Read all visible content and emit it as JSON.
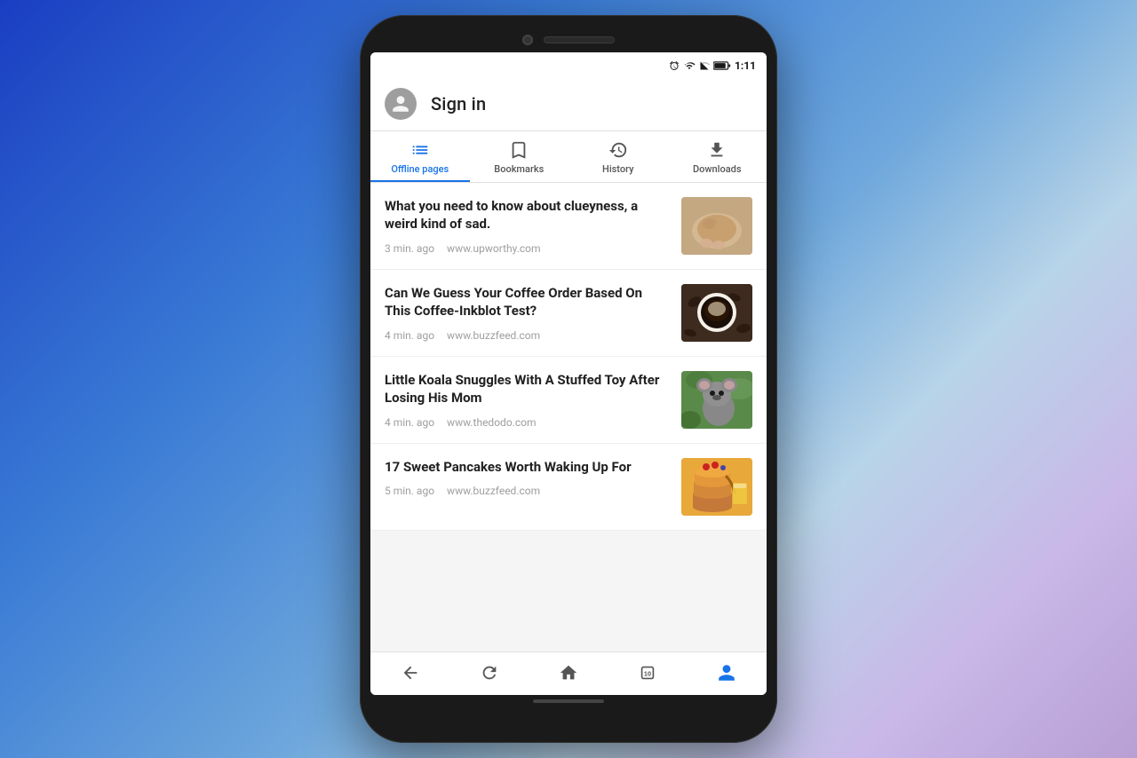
{
  "phone": {
    "status_bar": {
      "time": "1:11",
      "icons": [
        "alarm",
        "wifi",
        "signal",
        "battery"
      ]
    },
    "header": {
      "sign_in_label": "Sign in"
    },
    "tabs": [
      {
        "id": "offline",
        "label": "Offline pages",
        "active": true
      },
      {
        "id": "bookmarks",
        "label": "Bookmarks",
        "active": false
      },
      {
        "id": "history",
        "label": "History",
        "active": false
      },
      {
        "id": "downloads",
        "label": "Downloads",
        "active": false
      }
    ],
    "articles": [
      {
        "title": "What you need to know about clueyness, a weird kind of sad.",
        "time": "3 min. ago",
        "source": "www.upworthy.com",
        "thumb_type": "dog"
      },
      {
        "title": "Can We Guess Your Coffee Order Based On This Coffee-Inkblot Test?",
        "time": "4 min. ago",
        "source": "www.buzzfeed.com",
        "thumb_type": "coffee"
      },
      {
        "title": "Little Koala Snuggles With A Stuffed Toy After Losing His Mom",
        "time": "4 min. ago",
        "source": "www.thedodo.com",
        "thumb_type": "koala"
      },
      {
        "title": "17 Sweet Pancakes Worth Waking Up For",
        "time": "5 min. ago",
        "source": "www.buzzfeed.com",
        "thumb_type": "pancakes"
      }
    ],
    "bottom_nav": {
      "back_label": "back",
      "refresh_label": "refresh",
      "home_label": "home",
      "tabs_label": "10",
      "account_label": "account"
    }
  },
  "colors": {
    "active_tab": "#1a73e8",
    "inactive_tab": "#555555",
    "text_primary": "#212121",
    "text_secondary": "#9e9e9e"
  }
}
